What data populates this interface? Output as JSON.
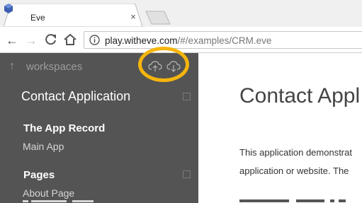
{
  "browser": {
    "tab": {
      "title": "Eve",
      "close_glyph": "×"
    },
    "nav": {
      "back": "←",
      "forward": "→",
      "reload": "C"
    },
    "address": {
      "host": "play.witheve.com",
      "path": "/#/examples/CRM.eve"
    }
  },
  "sidebar": {
    "workspaces_label": "workspaces",
    "icons": [
      "cloud-upload-icon",
      "cloud-download-icon"
    ],
    "app_title": "Contact Application",
    "sections": [
      {
        "heading": "The App Record",
        "items": [
          "Main App"
        ]
      },
      {
        "heading": "Pages",
        "items": [
          "About Page"
        ]
      }
    ]
  },
  "content": {
    "title": "Contact Appl",
    "lines": [
      "This application demonstrat",
      "application or website. The"
    ]
  },
  "colors": {
    "sidebar_bg": "#545454",
    "highlight": "#f5b50c",
    "favicon": "#3d5fb0"
  }
}
